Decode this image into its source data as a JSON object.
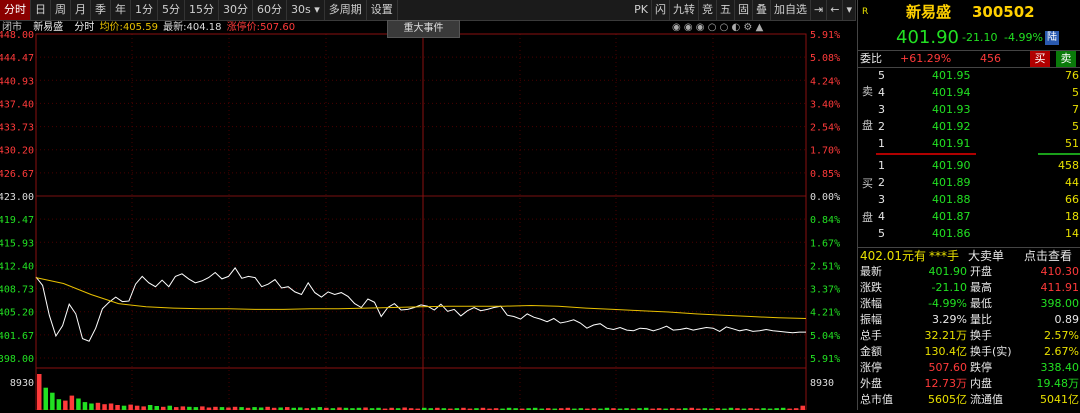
{
  "toolbar": {
    "tabs": [
      "分时",
      "日",
      "周",
      "月",
      "季",
      "年",
      "1分",
      "5分",
      "15分",
      "30分",
      "60分",
      "30s ▾",
      "多周期",
      "设置"
    ],
    "active_index": 0,
    "right_tools": [
      "PK",
      "闪",
      "九转",
      "竞",
      "五",
      "固",
      "叠",
      "加自选",
      "⇥",
      "←",
      "▾"
    ]
  },
  "chart": {
    "status": "闭市",
    "name": "新易盛",
    "mode": "分时",
    "avg_label": "均价:",
    "avg_value": "405.59",
    "last_label": "最新:",
    "last_value": "404.18",
    "limit_up_label": "涨停价:",
    "limit_up_value": "507.60",
    "event_button": "重大事件",
    "icons": "◉ ◉ ◉ ○ ○ ◐ ⚙ ▲",
    "price_levels": [
      "448.00",
      "444.47",
      "440.93",
      "437.40",
      "433.73",
      "430.20",
      "426.67",
      "423.00",
      "419.47",
      "415.93",
      "412.40",
      "408.73",
      "405.20",
      "401.67",
      "398.00"
    ],
    "pct_levels": [
      "5.91%",
      "5.08%",
      "4.24%",
      "3.40%",
      "2.54%",
      "1.70%",
      "0.85%",
      "0.00%",
      "0.84%",
      "1.67%",
      "2.51%",
      "3.37%",
      "4.21%",
      "5.04%",
      "5.91%"
    ],
    "volume_label": "8930",
    "colors": {
      "up": "#ff3a3a",
      "down": "#22e022",
      "grid": "#4a0000",
      "price": "#ffffff",
      "avg": "#e8c000"
    },
    "price_series": [
      410.5,
      409.2,
      404.6,
      401.4,
      403.0,
      406.3,
      404.8,
      401.0,
      400.6,
      402.6,
      405.6,
      406.6,
      407.4,
      406.7,
      406.8,
      409.4,
      410.6,
      409.6,
      409.0,
      410.0,
      409.0,
      410.6,
      411.0,
      410.2,
      409.6,
      409.9,
      410.4,
      411.2,
      410.2,
      410.6,
      411.9,
      410.3,
      410.6,
      410.4,
      409.0,
      409.4,
      410.1,
      408.8,
      409.0,
      408.2,
      407.8,
      409.6,
      408.1,
      407.4,
      408.2,
      407.8,
      408.1,
      407.5,
      406.4,
      405.8,
      407.1,
      406.6,
      404.4,
      405.8,
      406.4,
      405.4,
      405.5,
      405.8,
      406.2,
      406.0,
      405.4,
      406.3,
      405.2,
      405.5,
      404.5,
      405.3,
      405.8,
      405.3,
      405.5,
      405.8,
      406.0,
      404.6,
      404.4,
      404.0,
      404.8,
      404.3,
      404.0,
      403.6,
      404.1,
      403.4,
      403.6,
      403.9,
      403.4,
      402.6,
      403.1,
      403.3,
      402.6,
      402.4,
      402.7,
      402.3,
      402.2,
      402.6,
      402.5,
      402.2,
      402.5,
      402.9,
      402.3,
      402.4,
      402.6,
      402.3,
      402.5,
      402.7,
      402.6,
      402.1,
      402.8,
      402.5,
      402.2,
      402.4,
      402.1,
      402.2,
      402.4,
      402.2,
      402.1,
      402.0,
      401.9,
      402.0,
      402.0
    ],
    "avg_series": [
      410.4,
      409.5,
      407.8,
      406.4,
      405.9,
      405.7,
      405.6,
      405.6,
      405.5,
      405.5,
      405.6,
      405.6,
      405.7,
      405.8,
      405.9,
      406.0,
      406.0,
      406.0,
      406.1,
      406.0,
      405.7,
      405.5,
      405.3,
      405.1,
      404.8,
      404.6,
      404.4,
      404.2,
      404.1
    ],
    "volume_series": [
      100,
      62,
      48,
      30,
      26,
      40,
      32,
      22,
      18,
      20,
      16,
      18,
      14,
      12,
      15,
      12,
      10,
      14,
      11,
      9,
      12,
      8,
      10,
      9,
      8,
      10,
      7,
      9,
      8,
      7,
      9,
      8,
      6,
      8,
      7,
      9,
      6,
      7,
      8,
      6,
      7,
      5,
      6,
      8,
      6,
      5,
      7,
      6,
      5,
      6,
      7,
      5,
      6,
      4,
      6,
      5,
      7,
      5,
      4,
      6,
      5,
      6,
      5,
      4,
      5,
      6,
      4,
      5,
      6,
      4,
      5,
      4,
      6,
      5,
      4,
      5,
      6,
      4,
      5,
      4,
      5,
      6,
      4,
      5,
      4,
      5,
      4,
      6,
      5,
      4,
      5,
      4,
      5,
      6,
      4,
      5,
      4,
      5,
      4,
      5,
      6,
      4,
      5,
      4,
      5,
      4,
      6,
      5,
      4,
      5,
      4,
      5,
      4,
      5,
      6,
      4,
      5,
      12
    ]
  },
  "quote": {
    "market_tag": "R",
    "name": "新易盛",
    "code": "300502",
    "price": "401.90",
    "change": "-21.10",
    "change_pct": "-4.99%",
    "badge": "陆",
    "weibi_label": "委比",
    "weibi_value": "+61.29%",
    "weicha_value": "456",
    "buy_btn": "买",
    "sell_btn": "卖",
    "sell_side_label": [
      "卖",
      "盘"
    ],
    "buy_side_label": [
      "买",
      "盘"
    ],
    "asks": [
      {
        "lvl": "5",
        "price": "401.95",
        "vol": "76"
      },
      {
        "lvl": "4",
        "price": "401.94",
        "vol": "5"
      },
      {
        "lvl": "3",
        "price": "401.93",
        "vol": "7"
      },
      {
        "lvl": "2",
        "price": "401.92",
        "vol": "5"
      },
      {
        "lvl": "1",
        "price": "401.91",
        "vol": "51"
      }
    ],
    "bids": [
      {
        "lvl": "1",
        "price": "401.90",
        "vol": "458"
      },
      {
        "lvl": "2",
        "price": "401.89",
        "vol": "44"
      },
      {
        "lvl": "3",
        "price": "401.88",
        "vol": "66"
      },
      {
        "lvl": "4",
        "price": "401.87",
        "vol": "18"
      },
      {
        "lvl": "5",
        "price": "401.86",
        "vol": "14"
      }
    ],
    "big_order_price": "402.01元有",
    "big_order_hand": "***手",
    "big_order_label": "大卖单",
    "big_order_link": "点击查看",
    "stats": [
      {
        "l1": "最新",
        "v1": "401.90",
        "c1": "green",
        "l2": "开盘",
        "v2": "410.30",
        "c2": "red"
      },
      {
        "l1": "涨跌",
        "v1": "-21.10",
        "c1": "green",
        "l2": "最高",
        "v2": "411.91",
        "c2": "red"
      },
      {
        "l1": "涨幅",
        "v1": "-4.99%",
        "c1": "green",
        "l2": "最低",
        "v2": "398.00",
        "c2": "green"
      },
      {
        "l1": "振幅",
        "v1": "3.29%",
        "c1": "white",
        "l2": "量比",
        "v2": "0.89",
        "c2": "white"
      },
      {
        "l1": "总手",
        "v1": "32.21万",
        "c1": "yellow",
        "l2": "换手",
        "v2": "2.57%",
        "c2": "yellow"
      },
      {
        "l1": "金额",
        "v1": "130.4亿",
        "c1": "yellow",
        "l2": "换手(实)",
        "v2": "2.67%",
        "c2": "yellow"
      },
      {
        "l1": "涨停",
        "v1": "507.60",
        "c1": "red",
        "l2": "跌停",
        "v2": "338.40",
        "c2": "green"
      },
      {
        "l1": "外盘",
        "v1": "12.73万",
        "c1": "red",
        "l2": "内盘",
        "v2": "19.48万",
        "c2": "green"
      },
      {
        "l1": "总市值",
        "v1": "5605亿",
        "c1": "yellow",
        "l2": "流通值",
        "v2": "5041亿",
        "c2": "yellow"
      }
    ]
  }
}
